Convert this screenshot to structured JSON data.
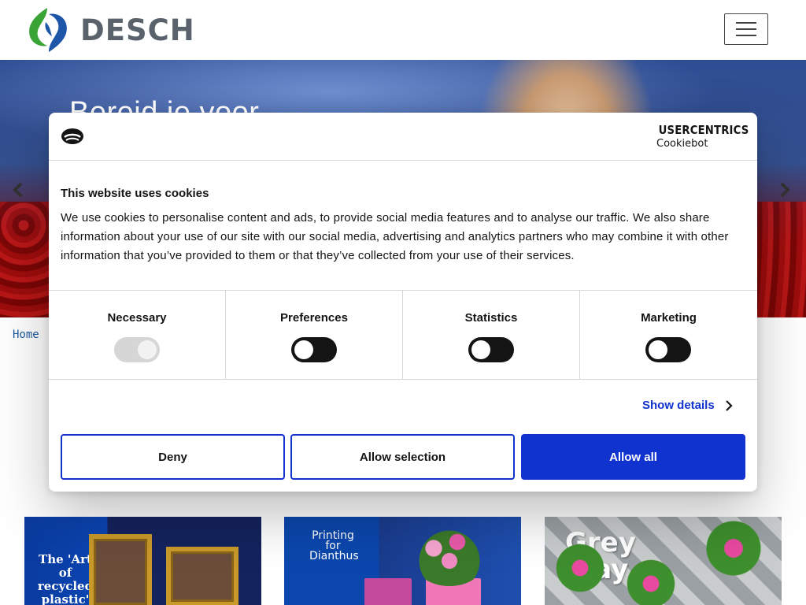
{
  "header": {
    "logo_text": "DESCH",
    "menu_label": "Menu"
  },
  "hero": {
    "title": "Bereid je voor"
  },
  "breadcrumb": {
    "home": "Home"
  },
  "tiles": [
    {
      "text": "The 'Art of recycled plastic'"
    },
    {
      "text": "Printing for Dianthus"
    },
    {
      "text": "Grey Tray"
    }
  ],
  "cookie_dialog": {
    "brand_line1": "USERCENTRICS",
    "brand_line2": "Cookiebot",
    "title": "This website uses cookies",
    "body": "We use cookies to personalise content and ads, to provide social media features and to analyse our traffic. We also share information about your use of our site with our social media, advertising and analytics partners who may combine it with other information that you’ve provided to them or that they’ve collected from your use of their services.",
    "categories": [
      {
        "label": "Necessary",
        "enabled": true,
        "locked": true
      },
      {
        "label": "Preferences",
        "enabled": false,
        "locked": false
      },
      {
        "label": "Statistics",
        "enabled": false,
        "locked": false
      },
      {
        "label": "Marketing",
        "enabled": false,
        "locked": false
      }
    ],
    "show_details": "Show details",
    "buttons": {
      "deny": "Deny",
      "allow_selection": "Allow selection",
      "allow_all": "Allow all"
    },
    "accent_color": "#1032cf"
  }
}
